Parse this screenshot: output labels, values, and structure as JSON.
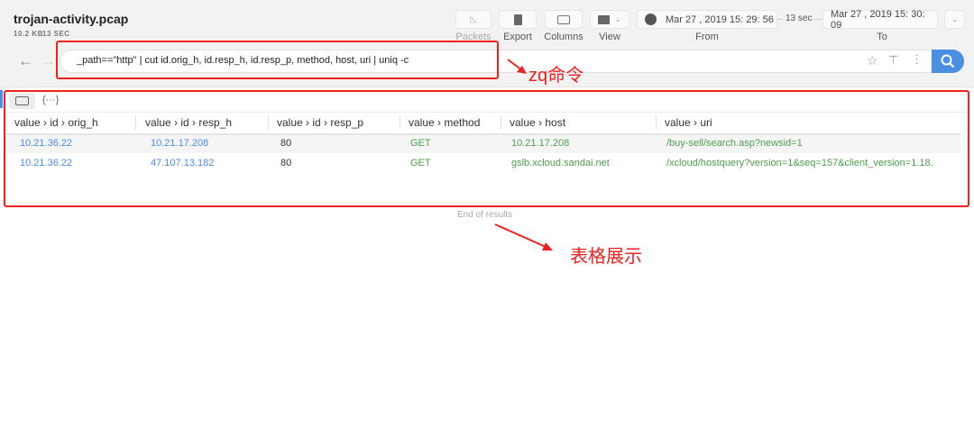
{
  "file": {
    "name": "trojan-activity.pcap",
    "size": "10.2 KB",
    "duration": "13 SEC"
  },
  "toolbar": {
    "packets": "Packets",
    "export": "Export",
    "columns": "Columns",
    "view": "View",
    "from_label": "From",
    "to_label": "To",
    "from_time": "Mar  27 , 2019  15: 29: 56",
    "span": "13 sec",
    "to_time": "Mar  27 , 2019  15: 30: 09"
  },
  "search": {
    "query": "_path==\"http\" | cut id.orig_h, id.resp_h, id.resp_p, method, host, uri | uniq -c"
  },
  "view_toggle": {
    "json_label": "{···}"
  },
  "table": {
    "headers": [
      "value › id › orig_h",
      "value › id › resp_h",
      "value › id › resp_p",
      "value › method",
      "value › host",
      "value › uri"
    ],
    "rows": [
      [
        "10.21.36.22",
        "10.21.17.208",
        "80",
        "GET",
        "10.21.17.208",
        "/buy-sell/search.asp?newsid=1"
      ],
      [
        "10.21.36.22",
        "47.107.13.182",
        "80",
        "GET",
        "gslb.xcloud.sandai.net",
        "/xcloud/hostquery?version=1&seq=157&client_version=1.18."
      ]
    ],
    "footer": "End of results"
  },
  "annotations": {
    "query_note": "zq命令",
    "table_note": "表格展示"
  },
  "colors": {
    "accent": "#4a90e2",
    "annotation": "#f0201e"
  }
}
